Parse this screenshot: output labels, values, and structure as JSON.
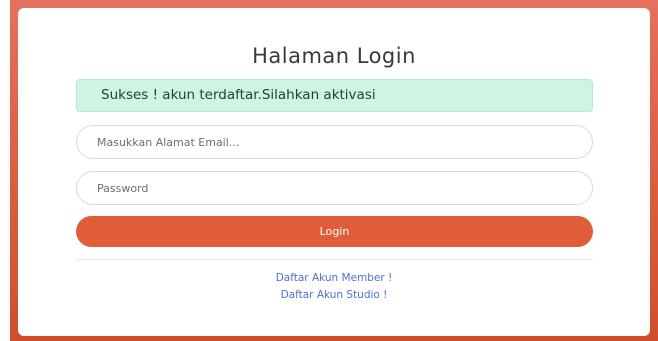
{
  "login": {
    "title": "Halaman Login",
    "alert": "Sukses ! akun terdaftar.Silahkan aktivasi",
    "email_placeholder": "Masukkan Alamat Email...",
    "password_placeholder": "Password",
    "login_button": "Login",
    "links": {
      "member": "Daftar Akun Member !",
      "studio": "Daftar Akun Studio !"
    }
  },
  "colors": {
    "background_gradient_top": "#e4705e",
    "background_gradient_bottom": "#cf4e2e",
    "button": "#df5d38",
    "alert_background": "#d1f3e4",
    "link": "#4e6fd6"
  }
}
